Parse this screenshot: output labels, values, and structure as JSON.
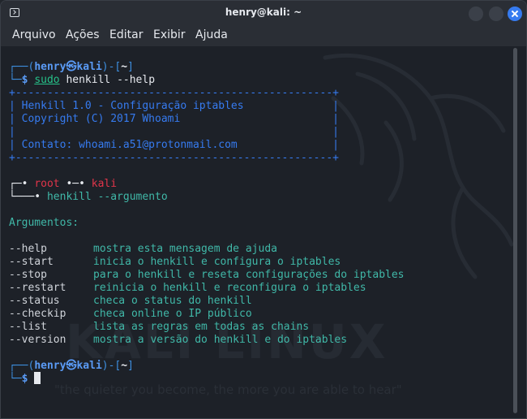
{
  "window": {
    "title": "henry@kali: ~"
  },
  "menu": [
    "Arquivo",
    "Ações",
    "Editar",
    "Exibir",
    "Ajuda"
  ],
  "terminal": {
    "prompt1": {
      "open": "┌──(",
      "user": "henry",
      "at": "㉿",
      "host": "kali",
      "mid": ")-[",
      "path": "~",
      "close": "]",
      "cont": "└─",
      "dollar": "$",
      "cmd_sudo": "sudo",
      "cmd_rest": " henkill --help"
    },
    "box": {
      "top": "+--------------------------------------------------+",
      "line1": "| Henkill 1.0 - Configuração iptables              |",
      "line2": "| Copyright (C) 2017 Whoami                        |",
      "line3": "|                                                  |",
      "line4": "| Contato: whoami.a51@protonmail.com               |",
      "bottom": "+--------------------------------------------------+"
    },
    "usage": {
      "line1_pre": "┌─• ",
      "root": "root",
      "sep": " •─• ",
      "host": "kali",
      "line2_pre": "└───• ",
      "cmd": "henkill --argumento"
    },
    "args_title": "Argumentos:",
    "args": [
      {
        "flag": "--help",
        "desc": "mostra esta mensagem de ajuda"
      },
      {
        "flag": "--start",
        "desc": "inicia o henkill e configura o iptables"
      },
      {
        "flag": "--stop",
        "desc": "para o henkill e reseta configurações do iptables"
      },
      {
        "flag": "--restart",
        "desc": "reinicia o henkill e reconfigura o iptables"
      },
      {
        "flag": "--status",
        "desc": "checa o status do henkill"
      },
      {
        "flag": "--checkip",
        "desc": "checa online o IP público"
      },
      {
        "flag": "--list",
        "desc": "lista as regras em todas as chains"
      },
      {
        "flag": "--version",
        "desc": "mostra a versão do henkill e do iptables"
      }
    ],
    "prompt2": {
      "open": "┌──(",
      "user": "henry",
      "at": "㉿",
      "host": "kali",
      "mid": ")-[",
      "path": "~",
      "close": "]",
      "cont": "└─",
      "dollar": "$"
    },
    "watermark": "KALI LINUX",
    "watermark_sub": "\"the quieter you become, the more you are able to hear\""
  },
  "colors": {
    "accent": "#367bf0",
    "teal": "#40b8a8",
    "red": "#e0354a",
    "background": "#1d2128"
  }
}
